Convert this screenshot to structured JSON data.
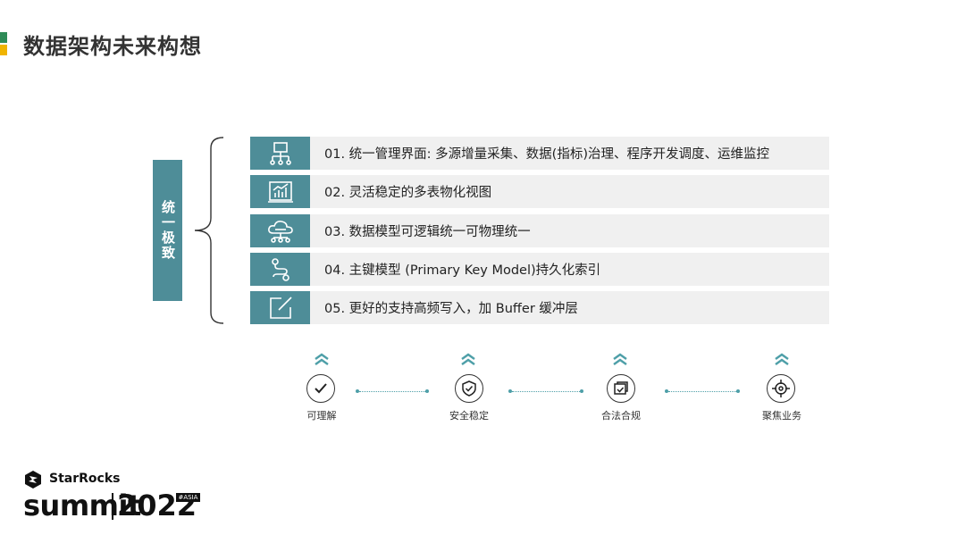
{
  "header": {
    "title": "数据架构未来构想"
  },
  "sidebar_label": "统一极致",
  "items": [
    {
      "text": "01. 统一管理界面: 多源增量采集、数据(指标)治理、程序开发调度、运维监控",
      "icon": "org-chart-icon"
    },
    {
      "text": "02. 灵活稳定的多表物化视图",
      "icon": "bar-chart-icon"
    },
    {
      "text": "03. 数据模型可逻辑统一可物理统一",
      "icon": "cloud-network-icon"
    },
    {
      "text": "04. 主键模型 (Primary Key Model)持久化索引",
      "icon": "path-route-icon"
    },
    {
      "text": "05. 更好的支持高频写入，加 Buffer 缓冲层",
      "icon": "edit-icon"
    }
  ],
  "flow": [
    {
      "label": "可理解",
      "icon": "check-icon"
    },
    {
      "label": "安全稳定",
      "icon": "shield-check-icon"
    },
    {
      "label": "合法合规",
      "icon": "document-check-icon"
    },
    {
      "label": "聚焦业务",
      "icon": "target-icon"
    }
  ],
  "logo": {
    "brand": "StarRocks",
    "event": "summit",
    "year": "2022",
    "tag": "#ASIA"
  },
  "colors": {
    "accent": "#4e8d98",
    "row_bg": "#f0f0f0",
    "title_green": "#2e8b57",
    "title_yellow": "#f0b400"
  }
}
